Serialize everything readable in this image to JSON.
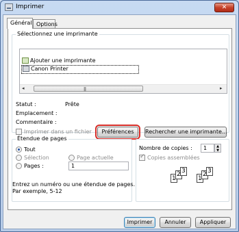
{
  "window": {
    "title": "Imprimer",
    "close_glyph": "✕"
  },
  "tabs": [
    {
      "label": "Général"
    },
    {
      "label": "Options"
    }
  ],
  "printer_group": {
    "legend": "Sélectionnez une imprimante",
    "items": [
      {
        "label": "Ajouter une imprimante",
        "icon": "add-printer-icon"
      },
      {
        "label": "Canon Printer",
        "icon": "printer-icon",
        "selected": true
      }
    ],
    "scrollbar": {
      "left": "◂",
      "right": "▸",
      "grip": "|||"
    }
  },
  "status": {
    "statut_label": "Statut :",
    "statut_value": "Prête",
    "emplacement_label": "Emplacement :",
    "commentaire_label": "Commentaire :"
  },
  "print_to_file": {
    "label": "Imprimer dans un fichier",
    "checked": false
  },
  "preferences_button": "Préférences",
  "find_printer_button": "Rechercher une imprimante...",
  "page_range": {
    "legend": "Étendue de pages",
    "options": [
      {
        "label": "Tout",
        "checked": true
      },
      {
        "label": "Sélection",
        "checked": false
      },
      {
        "label": "Page actuelle",
        "checked": false
      },
      {
        "label": "Pages :",
        "checked": false
      }
    ],
    "pages_value": "1",
    "hint_line1": "Entrez un numéro ou une étendue de pages.",
    "hint_line2": "Par exemple, 5-12"
  },
  "copies": {
    "label": "Nombre de copies :",
    "value": "1",
    "collate_label": "Copies assemblées",
    "collate_checked": true,
    "collate_numbers": [
      "1",
      "2",
      "3",
      "1",
      "2",
      "3"
    ]
  },
  "footer": {
    "print_button": "Imprimer",
    "cancel_button": "Annuler",
    "apply_button": "Appliquer"
  },
  "colors": {
    "focus_outline": "#d52b26",
    "title_bar": "#c7daf2"
  }
}
